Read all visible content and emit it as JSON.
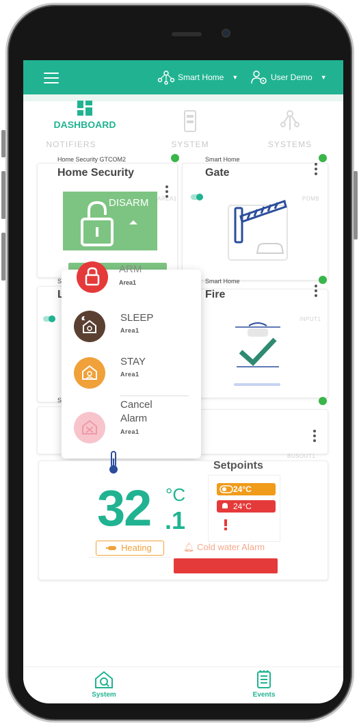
{
  "header": {
    "home_label": "Smart Home",
    "user_label": "User Demo"
  },
  "tabs": [
    {
      "label": "DASHBOARD"
    },
    {
      "label": "SYSTEM"
    },
    {
      "label": "SYSTEMS"
    }
  ],
  "behind_tab": {
    "label": "NOTIFIERS"
  },
  "cards": {
    "home_security": {
      "subtitle": "Home Security GTCOM2",
      "title": "Home Security",
      "tag": "AREA1"
    },
    "gate": {
      "subtitle": "Smart Home",
      "title": "Gate",
      "tag": "PDMB"
    },
    "left_middle": {
      "subtitle": "Sm",
      "title": "L"
    },
    "fire": {
      "subtitle": "Smart Home",
      "title": "Fire",
      "tag": "INPUT1"
    },
    "left_lower": {
      "subtitle": "Sm"
    },
    "right_lower": {
      "tag": "BUSOUT1"
    }
  },
  "security": {
    "state_label": "DISARM",
    "options": [
      {
        "label": "ARM",
        "area": "Area1"
      },
      {
        "label": "SLEEP",
        "area": "Area1"
      },
      {
        "label": "STAY",
        "area": "Area1"
      },
      {
        "label": "Cancel\nAlarm",
        "area": "Area1"
      }
    ]
  },
  "thermostat": {
    "temperature_int": "32",
    "temperature_dec": ".1",
    "unit": "°C",
    "setpoints_title": "Setpoints",
    "setpoint_1": "24°C",
    "setpoint_2": "24°C",
    "heating_label": "Heating",
    "alarm_label": "Cold water Alarm"
  },
  "bottom_nav": [
    {
      "label": "System"
    },
    {
      "label": "Events"
    }
  ],
  "colors": {
    "accent": "#21b391",
    "status_green": "#3ab54a",
    "alarm_red": "#e53a3a",
    "setpoint_orange": "#f09b1a"
  }
}
